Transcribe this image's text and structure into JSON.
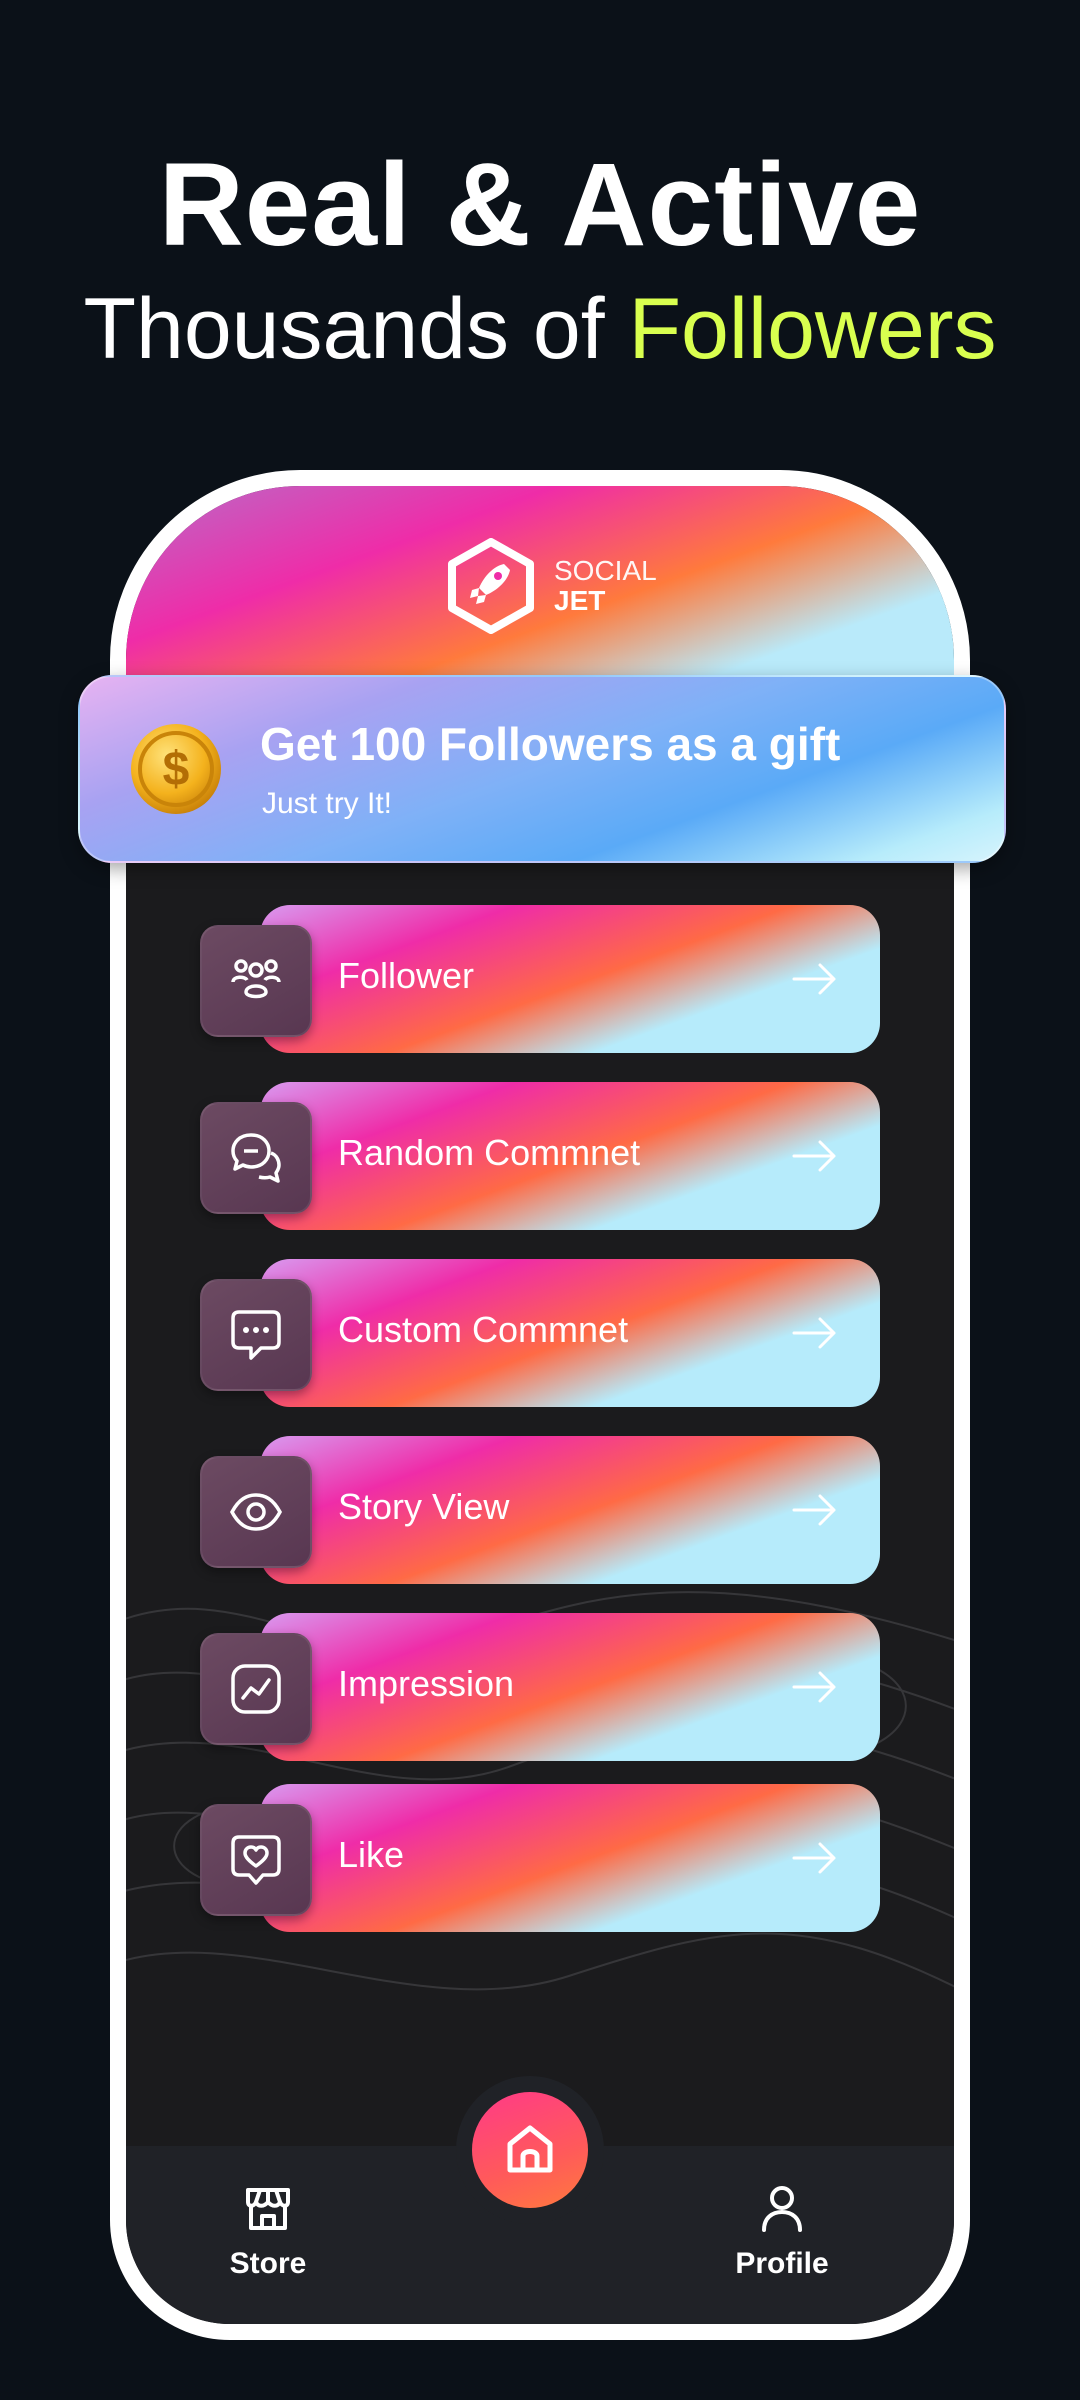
{
  "headline": {
    "line1": "Real & Active",
    "line2_prefix": "Thousands of ",
    "line2_accent": "Followers"
  },
  "brand": {
    "line1": "SOCIAL",
    "line2": "JET",
    "logo_icon": "rocket-hexagon-icon"
  },
  "gift_banner": {
    "title": "Get 100 Followers as a gift",
    "subtitle": "Just try It!",
    "icon": "dollar-coin-icon"
  },
  "menu": [
    {
      "label": "Follower",
      "icon": "followers-group-icon"
    },
    {
      "label": "Random Commnet",
      "icon": "chat-bubbles-icon"
    },
    {
      "label": "Custom Commnet",
      "icon": "chat-dots-icon"
    },
    {
      "label": "Story View",
      "icon": "eye-icon"
    },
    {
      "label": "Impression",
      "icon": "trend-chart-icon"
    },
    {
      "label": "Like",
      "icon": "heart-bubble-icon"
    }
  ],
  "bottom_nav": {
    "store": "Store",
    "profile": "Profile",
    "home_icon": "home-icon"
  },
  "colors": {
    "background": "#0b1118",
    "accent": "#d9ff4f",
    "panel": "#1b1b1d",
    "navbar": "#202227"
  }
}
